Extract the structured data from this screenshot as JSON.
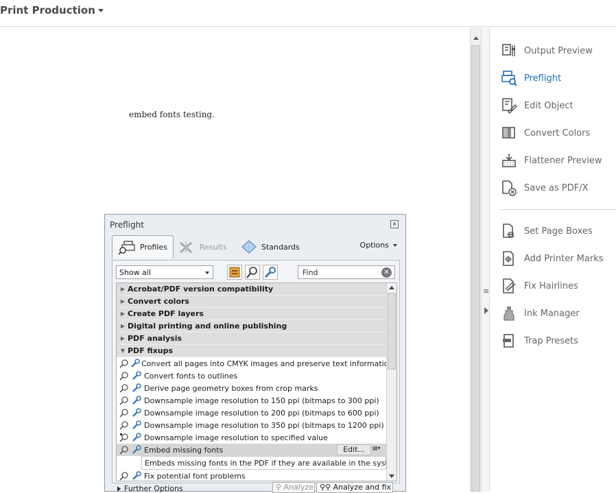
{
  "header": {
    "title": "Print Production"
  },
  "document": {
    "text": "embed fonts testing."
  },
  "tools": {
    "items": [
      {
        "label": "Output Preview",
        "icon": "output-preview-icon"
      },
      {
        "label": "Preflight",
        "icon": "preflight-icon",
        "active": true
      },
      {
        "label": "Edit Object",
        "icon": "edit-object-icon"
      },
      {
        "label": "Convert Colors",
        "icon": "convert-colors-icon"
      },
      {
        "label": "Flattener Preview",
        "icon": "flattener-preview-icon"
      },
      {
        "label": "Save as PDF/X",
        "icon": "save-pdfx-icon"
      },
      {
        "label": "Set Page Boxes",
        "icon": "set-page-boxes-icon"
      },
      {
        "label": "Add Printer Marks",
        "icon": "printer-marks-icon"
      },
      {
        "label": "Fix Hairlines",
        "icon": "fix-hairlines-icon"
      },
      {
        "label": "Ink Manager",
        "icon": "ink-manager-icon"
      },
      {
        "label": "Trap Presets",
        "icon": "trap-presets-icon"
      }
    ],
    "accent_color": "#1a6fb8"
  },
  "preflight": {
    "title": "Preflight",
    "close": "x",
    "tabs": {
      "profiles": "Profiles",
      "results": "Results",
      "standards": "Standards"
    },
    "options": "Options",
    "filter": "Show all",
    "find_placeholder": "Find",
    "groups": [
      "Acrobat/PDF version compatibility",
      "Convert colors",
      "Create PDF layers",
      "Digital printing and online publishing",
      "PDF analysis",
      "PDF fixups"
    ],
    "items": [
      "Convert all pages into CMYK images and preserve text information",
      "Convert fonts to outlines",
      "Derive page geometry boxes from crop marks",
      "Downsample image resolution to 150 ppi (bitmaps to 300 ppi)",
      "Downsample image resolution to 200 ppi (bitmaps to 600 ppi)",
      "Downsample image resolution to 350 ppi (bitmaps to 1200 ppi)",
      "Downsample image resolution to specified value"
    ],
    "selected": {
      "label": "Embed missing fonts",
      "edit": "Edit...",
      "description": "Embeds missing fonts in the PDF if they are available in the system."
    },
    "after_item": "Fix potential font problems",
    "further_options": "Further Options",
    "analyze": "Analyze",
    "analyze_fix": "Analyze and fix"
  }
}
